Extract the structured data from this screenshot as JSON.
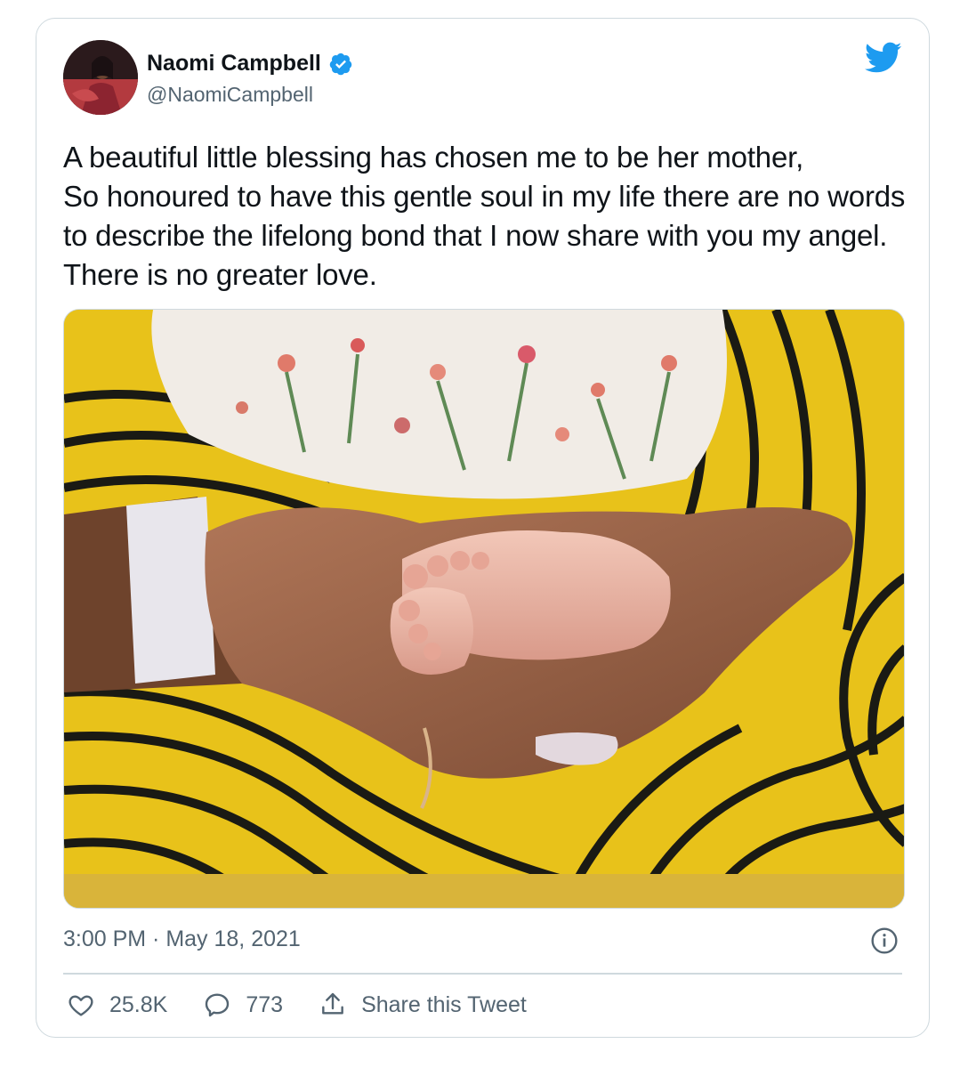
{
  "tweet": {
    "author": {
      "name": "Naomi Campbell",
      "handle": "@NaomiCampbell",
      "verified": true
    },
    "text": "A beautiful little blessing has chosen me to be her mother,\nSo honoured to have this gentle soul in my life  there are no words to describe the lifelong bond that I now share with you my angel. There is no greater love.",
    "timestamp": "3:00 PM · May 18, 2021",
    "likes": "25.8K",
    "replies": "773",
    "share_label": "Share this Tweet"
  },
  "colors": {
    "twitter_blue": "#1d9bf0",
    "secondary_text": "#536471",
    "border": "#cfd9de"
  },
  "icons": [
    "twitter-bird-icon",
    "verified-badge-icon",
    "info-icon",
    "heart-icon",
    "reply-bubble-icon",
    "share-icon"
  ]
}
